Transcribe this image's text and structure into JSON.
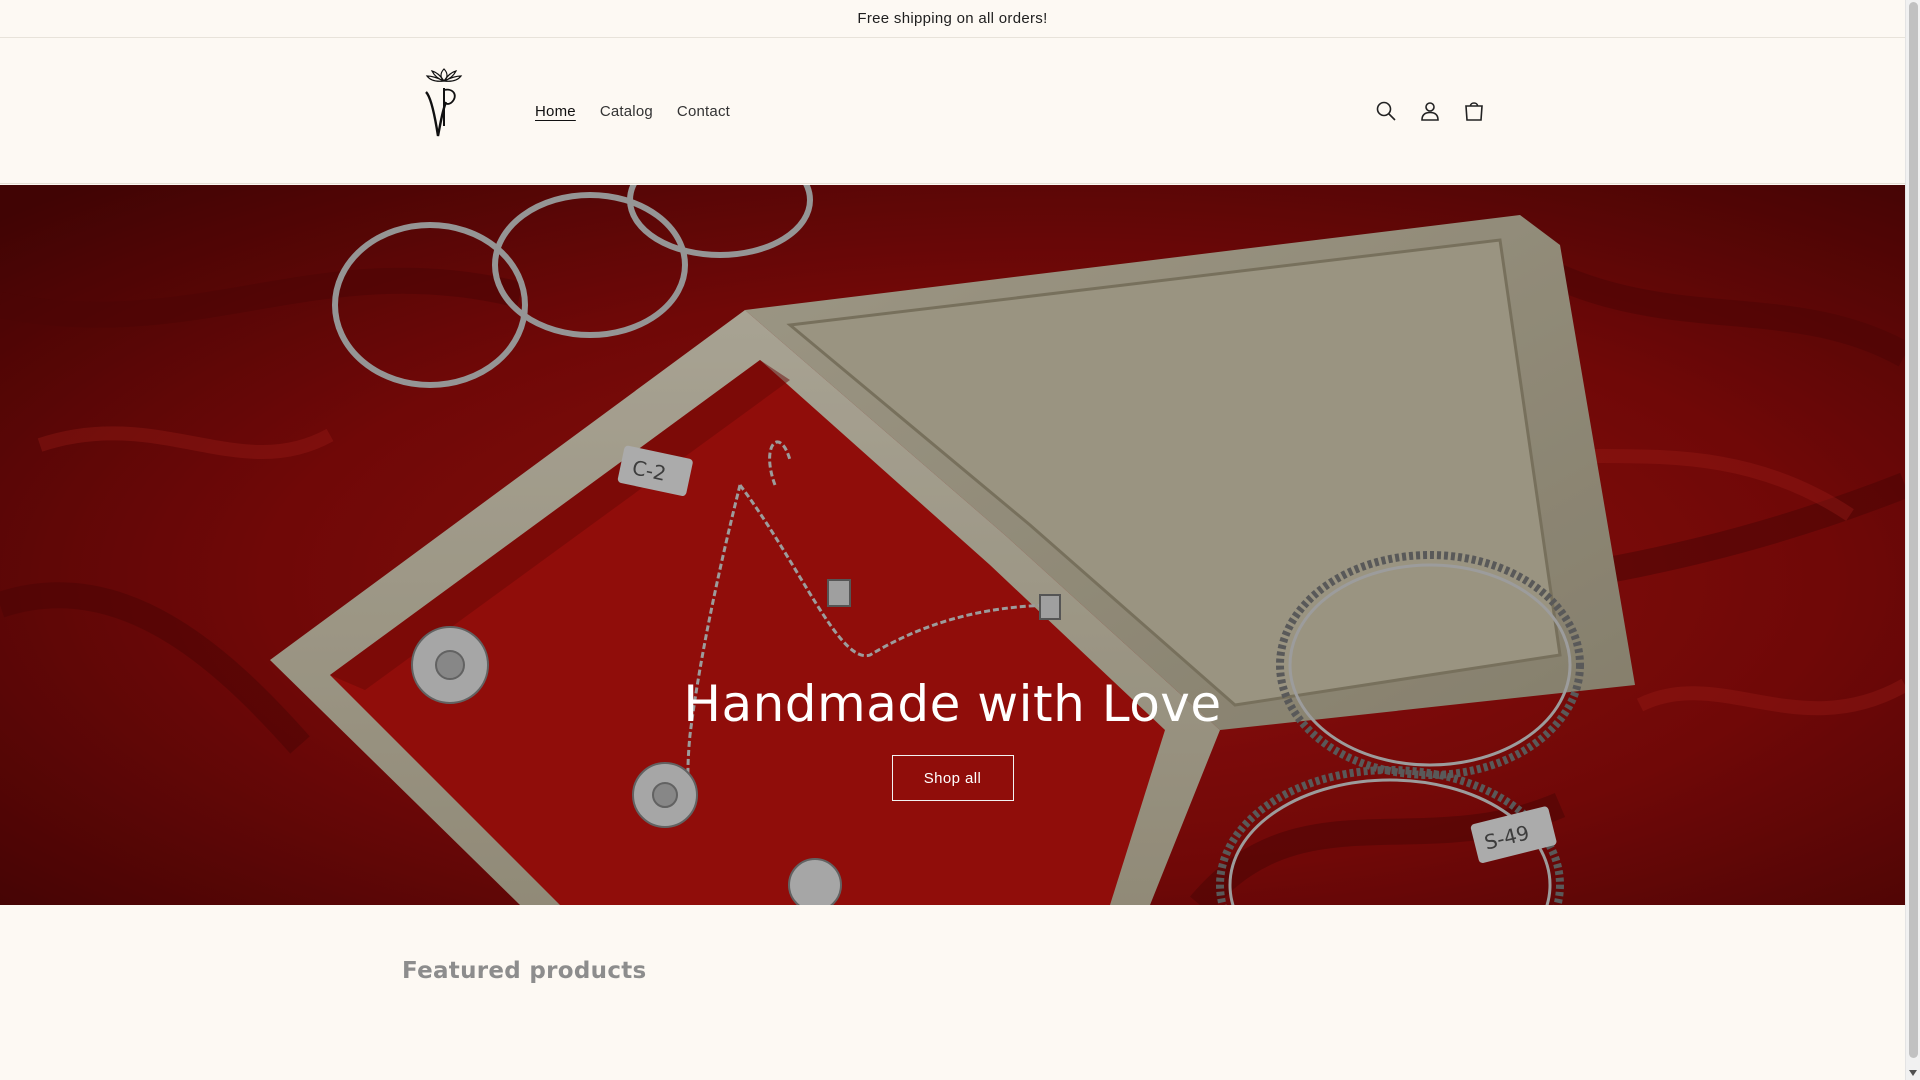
{
  "announcement": {
    "text": "Free shipping on all orders!"
  },
  "header": {
    "logo_alt": "logo",
    "nav": [
      {
        "label": "Home",
        "active": true
      },
      {
        "label": "Catalog",
        "active": false
      },
      {
        "label": "Contact",
        "active": false
      }
    ],
    "icons": [
      "search-icon",
      "account-icon",
      "cart-icon"
    ]
  },
  "hero": {
    "title": "Handmade with Love",
    "button_label": "Shop all"
  },
  "featured": {
    "heading": "Featured products"
  },
  "colors": {
    "page_bg": "#fdf9f3",
    "hero_red": "#9a0e0e",
    "text": "#1a1a1a"
  }
}
